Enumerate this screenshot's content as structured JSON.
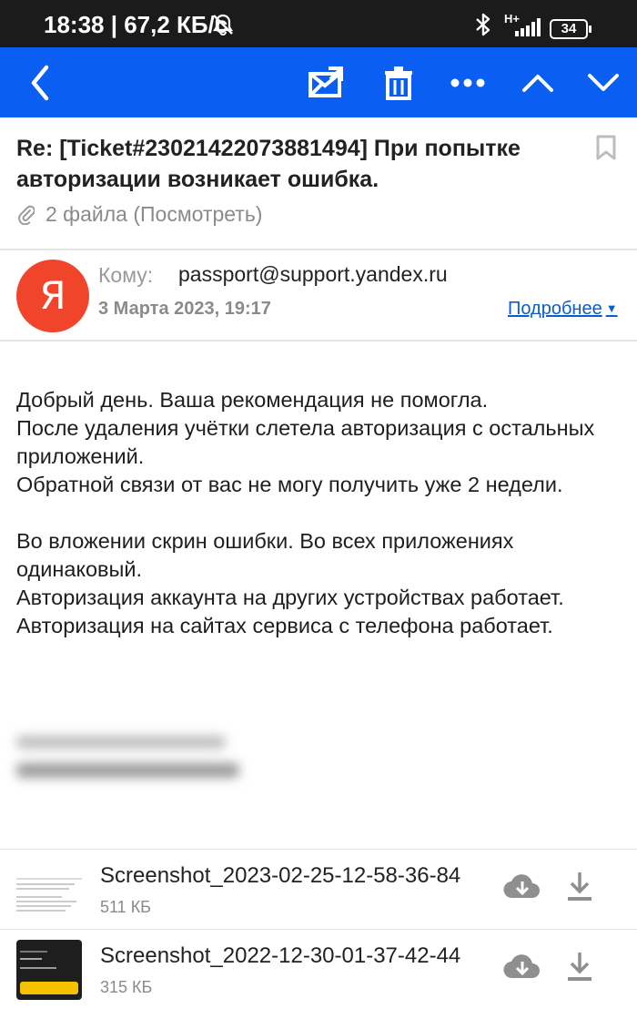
{
  "status_bar": {
    "time_text": "18:38 | 67,2 КБ/с",
    "network": "H+",
    "battery": "34"
  },
  "toolbar": {
    "back_icon": "chevron-left-icon",
    "move_icon": "folder-move-icon",
    "delete_icon": "trash-icon",
    "more_icon": "more-dots-icon",
    "prev_icon": "chevron-up-icon",
    "next_icon": "chevron-down-icon",
    "color": "#0b5ef2"
  },
  "message": {
    "subject": "Re: [Ticket#23021422073881494] При попытке авторизации возникает ошибка.",
    "attachments_link": "2 файла (Посмотреть)",
    "avatar_letter": "Я",
    "avatar_color": "#f1452b",
    "to_label": "Кому:",
    "to_value": "passport@support.yandex.ru",
    "date": "3 Марта 2023, 19:17",
    "details_label": "Подробнее"
  },
  "body": {
    "lines": [
      "Добрый день. Ваша рекомендация не помогла.",
      "После удаления учётки слетела авторизация с остальных приложений.",
      "Обратной связи от вас не могу получить уже 2 недели.",
      "Во вложении скрин ошибки. Во всех приложениях одинаковый.",
      "Авторизация аккаунта на других устройствах работает. Авторизация на сайтах сервиса с телефона работает."
    ]
  },
  "attachments": [
    {
      "name": "Screenshot_2023-02-25-12-58-36-84",
      "size": "511 КБ"
    },
    {
      "name": "Screenshot_2022-12-30-01-37-42-44",
      "size": "315 КБ"
    }
  ]
}
